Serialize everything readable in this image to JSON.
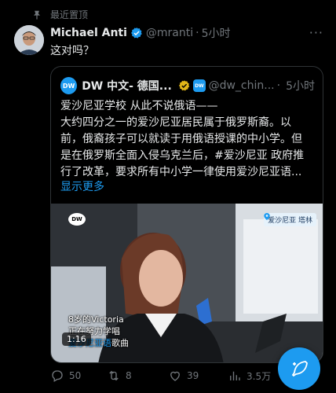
{
  "pinned_label": "最近置顶",
  "tweet": {
    "author_name": "Michael Anti",
    "handle": "@mranti",
    "dot": "·",
    "time": "5小时",
    "more": "···",
    "text": "这对吗？"
  },
  "quote": {
    "author_name": "DW 中文- 德国...",
    "handle": "@dw_chin...",
    "dot": "·",
    "time": "5小时",
    "logo_text": "DW",
    "body_lines": [
      "爱沙尼亚学校 从此不说俄语——",
      "大约四分之一的爱沙尼亚居民属于俄罗斯裔。以",
      "前，俄裔孩子可以就读于用俄语授课的中小学。但",
      "是在俄罗斯全面入侵乌克兰后，#爱沙尼亚 政府推",
      "行了改革，要求所有中小学一律使用爱沙尼亚语..."
    ],
    "show_more": "显示更多",
    "media": {
      "watermark": "DW",
      "location": "爱沙尼亚 塔林",
      "caption_line1": "8岁的Victoria",
      "caption_line2": "正在努力学唱",
      "caption_line3_hl": "爱沙尼亚语",
      "caption_line3_rest": "歌曲",
      "duration": "1:16"
    }
  },
  "actions": {
    "replies": "50",
    "retweets": "8",
    "likes": "39",
    "views": "3.5万"
  },
  "colors": {
    "accent": "#1d9bf0",
    "muted": "#71767b",
    "border": "#2f3336",
    "gold": "#e2b719"
  }
}
